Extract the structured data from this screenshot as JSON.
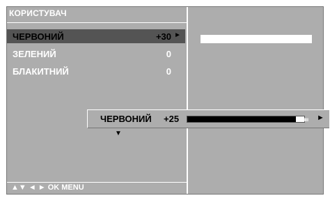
{
  "menu": {
    "title": "КОРИСТУВАЧ",
    "items": [
      {
        "label": "ЧЕРВОНИЙ",
        "value": "+30",
        "arrow": "►"
      },
      {
        "label": "ЗЕЛЕНИЙ",
        "value": "0"
      },
      {
        "label": "БЛАКИТНИЙ",
        "value": "0"
      }
    ],
    "nav_hint": "▲▼  ◄ ►  OK  MENU"
  },
  "popup": {
    "label": "ЧЕРВОНИЙ",
    "value": "+25",
    "level_fraction": 0.93,
    "ticks": "ıııııı",
    "right_arrow": "►",
    "down_arrow": "▼"
  },
  "colors": {
    "panel_bg": "#adadad",
    "selected_bg": "#545454"
  }
}
